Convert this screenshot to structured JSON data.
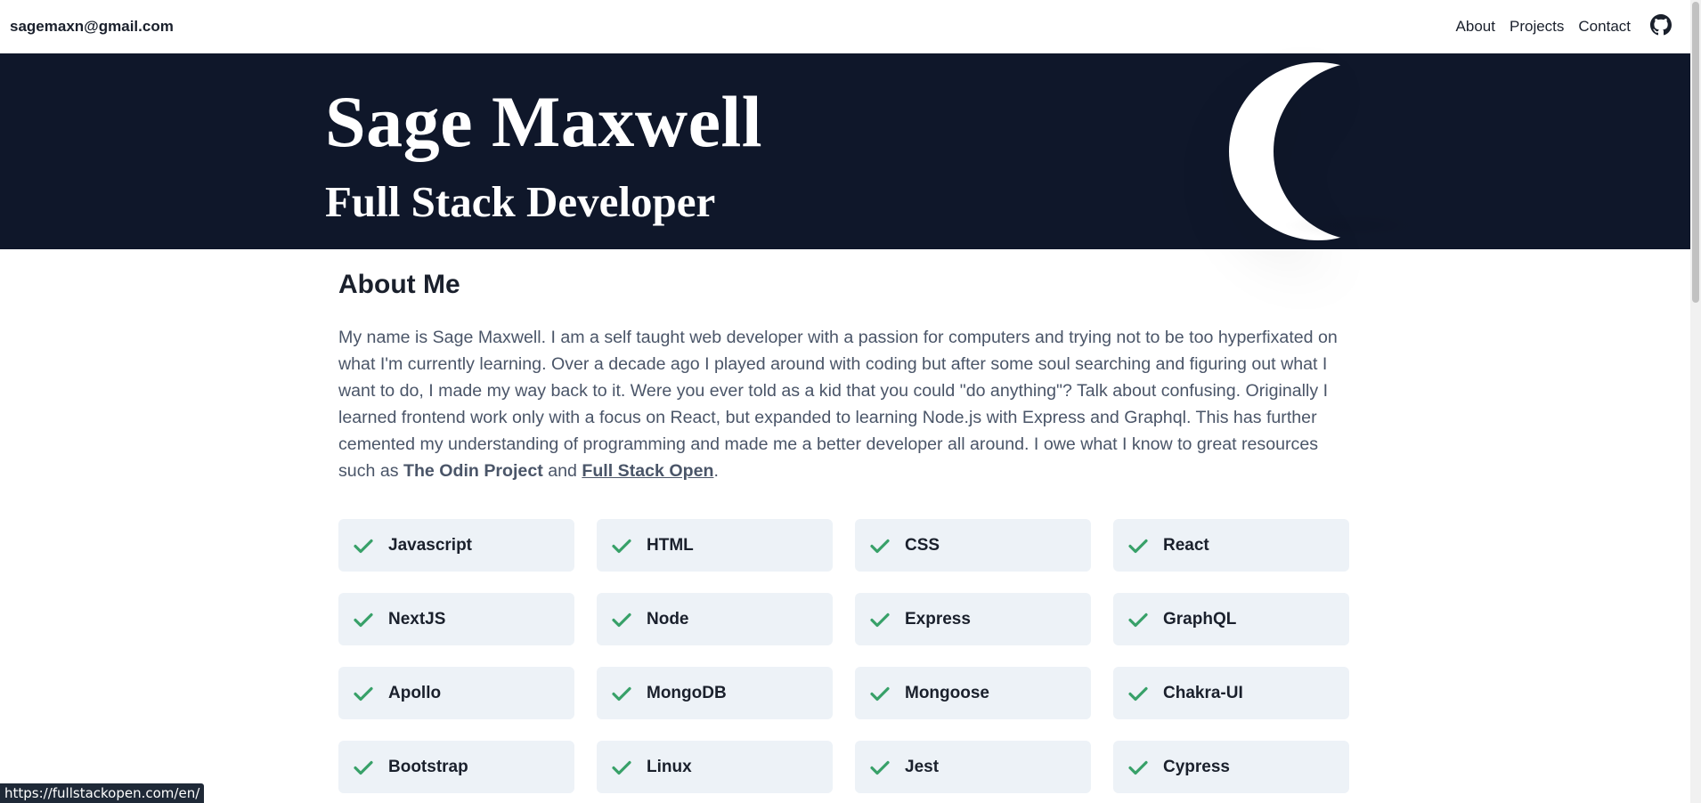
{
  "nav": {
    "email": "sagemaxn@gmail.com",
    "links": [
      "About",
      "Projects",
      "Contact"
    ],
    "github_icon": "github-icon"
  },
  "hero": {
    "name": "Sage Maxwell",
    "title": "Full Stack Developer",
    "background": "#0f172a",
    "moon_icon": "crescent-moon-icon"
  },
  "about": {
    "heading": "About Me",
    "text_before": "My name is Sage Maxwell. I am a self taught web developer with a passion for computers and trying not to be too hyperfixated on what I'm currently learning. Over a decade ago I played around with coding but after some soul searching and figuring out what I want to do, I made my way back to it. Were you ever told as a kid that you could \"do anything\"? Talk about confusing. Originally I learned frontend work only with a focus on React, but expanded to learning Node.js with Express and Graphql. This has further cemented my understanding of programming and made me a better developer all around. I owe what I know to great resources such as ",
    "odin": "The Odin Project",
    "and": " and ",
    "fso": "Full Stack Open",
    "period": "."
  },
  "skills": [
    "Javascript",
    "HTML",
    "CSS",
    "React",
    "NextJS",
    "Node",
    "Express",
    "GraphQL",
    "Apollo",
    "MongoDB",
    "Mongoose",
    "Chakra-UI",
    "Bootstrap",
    "Linux",
    "Jest",
    "Cypress"
  ],
  "check_color": "#38a169",
  "status_url": "https://fullstackopen.com/en/"
}
